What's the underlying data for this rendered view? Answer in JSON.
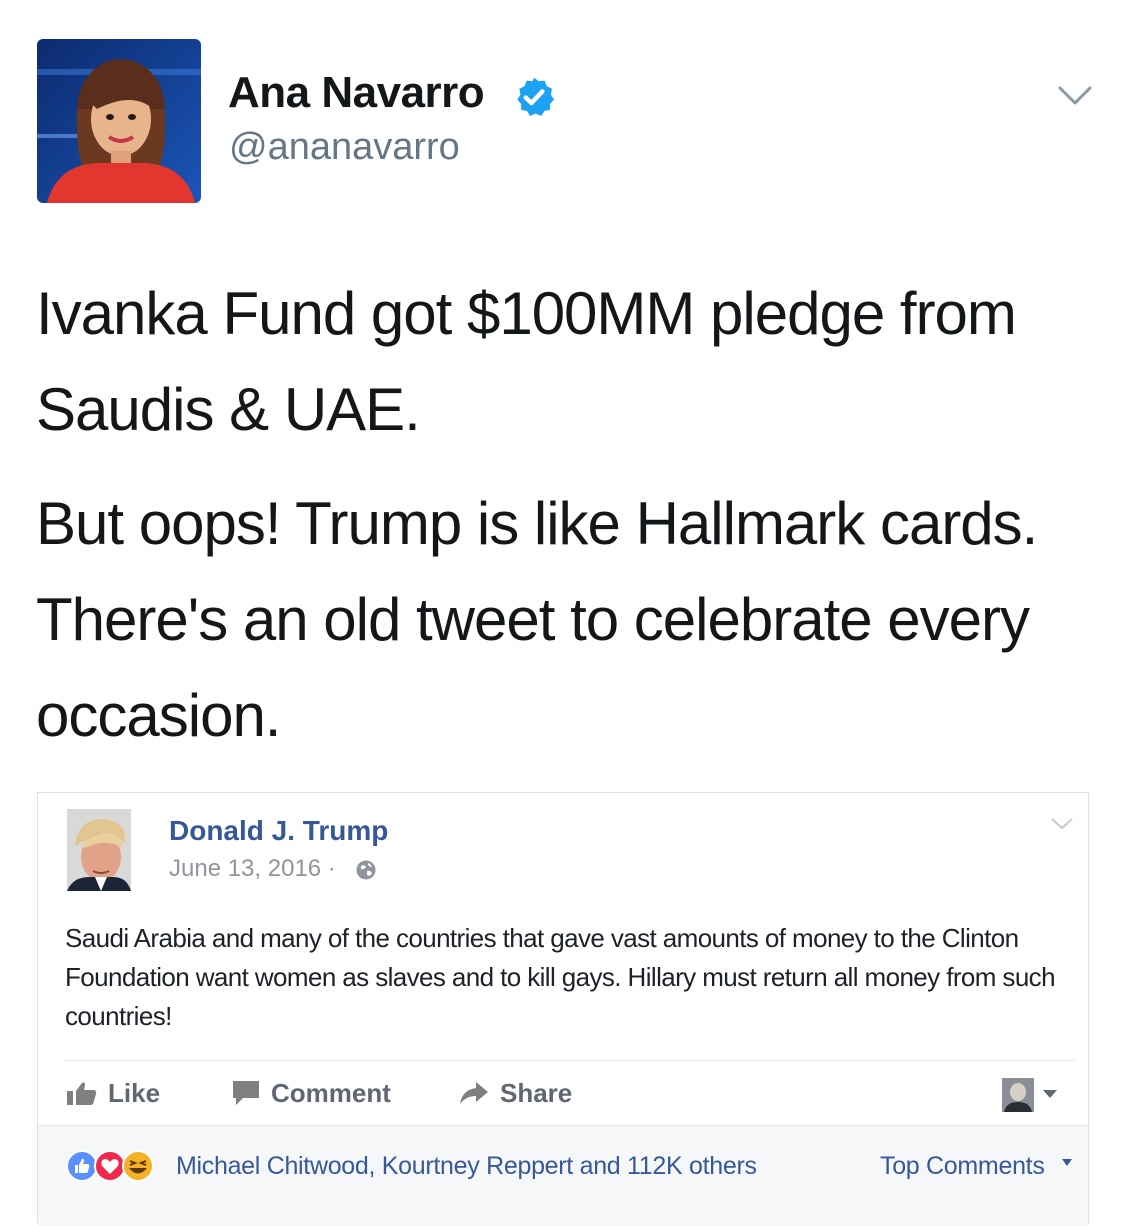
{
  "tweet": {
    "author_name": "Ana Navarro",
    "handle": "@ananavarro",
    "paragraphs": [
      "Ivanka Fund got $100MM pledge from Saudis & UAE.",
      "But oops! Trump is like Hallmark cards. There's an old tweet to celebrate every occasion."
    ]
  },
  "embedded_post": {
    "author_name": "Donald J. Trump",
    "date": "June 13, 2016 ·",
    "text": "Saudi Arabia and many of the countries that gave vast amounts of money to the Clinton Foundation want women as slaves and to kill gays. Hillary must return all money from such countries!",
    "actions": {
      "like": "Like",
      "comment": "Comment",
      "share": "Share"
    },
    "reactions_text": "Michael Chitwood, Kourtney Reppert and 112K others",
    "sort_label": "Top Comments"
  },
  "colors": {
    "verified_blue": "#1da1f2",
    "facebook_link": "#365899",
    "like_blue": "#5890ff",
    "love_red": "#f0284a",
    "haha_yellow": "#f7b125"
  },
  "icons": [
    "verified-badge-icon",
    "chevron-down-icon",
    "globe-icon",
    "like-thumb-icon",
    "comment-bubble-icon",
    "share-arrow-icon",
    "like-reaction-icon",
    "love-reaction-icon",
    "haha-reaction-icon",
    "caret-down-icon"
  ]
}
